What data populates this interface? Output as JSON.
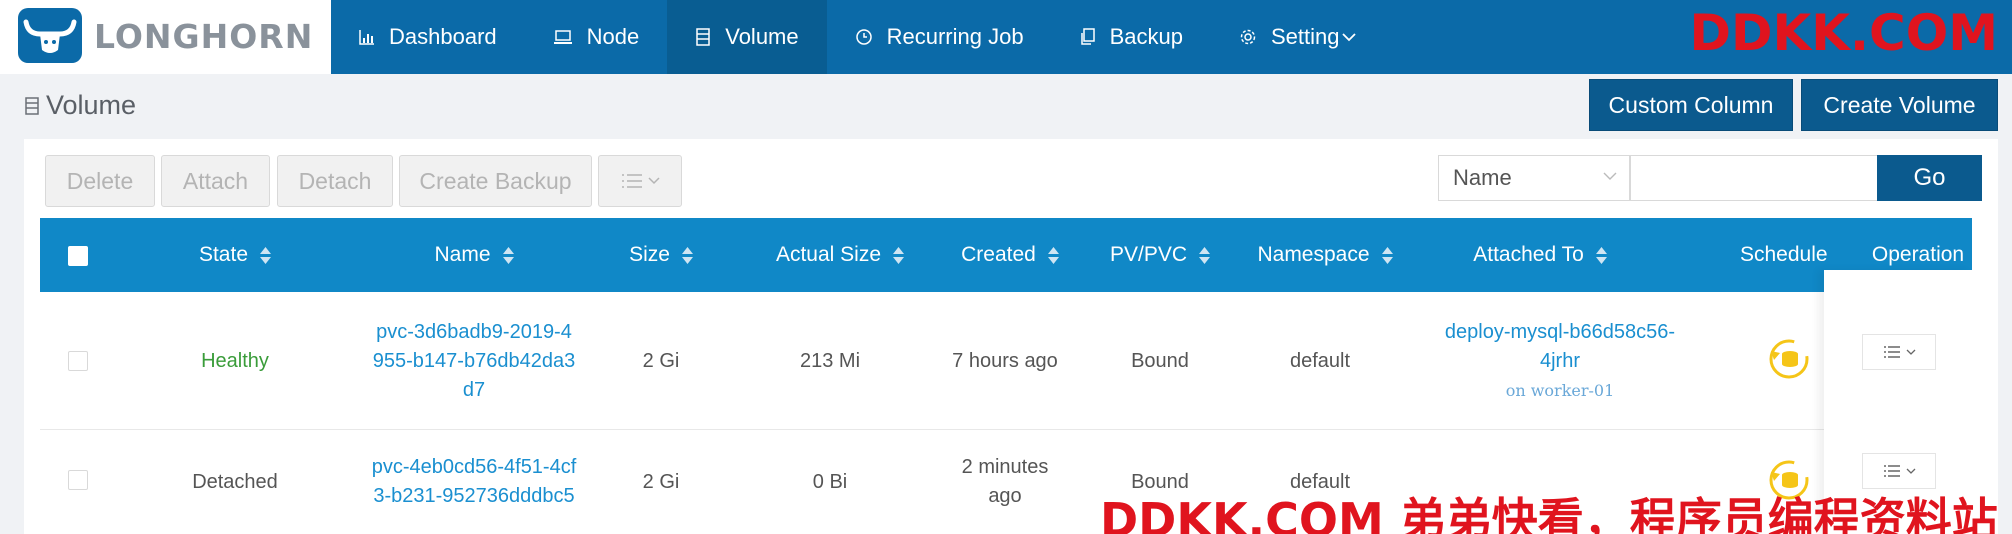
{
  "brand": {
    "name": "LONGHORN",
    "logo_icon": "longhorn-logo-icon"
  },
  "nav": {
    "items": [
      {
        "label": "Dashboard",
        "icon": "bar-chart-icon",
        "active": false
      },
      {
        "label": "Node",
        "icon": "laptop-icon",
        "active": false
      },
      {
        "label": "Volume",
        "icon": "database-icon",
        "active": true
      },
      {
        "label": "Recurring Job",
        "icon": "clock-icon",
        "active": false
      },
      {
        "label": "Backup",
        "icon": "copy-icon",
        "active": false
      },
      {
        "label": "Setting",
        "icon": "gear-icon",
        "active": false
      }
    ]
  },
  "watermark": {
    "top": "DDKK.COM",
    "bottom": "DDKK.COM 弟弟快看，程序员编程资料站"
  },
  "page": {
    "title": "Volume",
    "custom_column_label": "Custom Column",
    "create_volume_label": "Create Volume"
  },
  "toolbar": {
    "delete_label": "Delete",
    "attach_label": "Attach",
    "detach_label": "Detach",
    "create_backup_label": "Create Backup"
  },
  "search": {
    "field_selected": "Name",
    "value": "",
    "go_label": "Go"
  },
  "table": {
    "headers": {
      "state": "State",
      "name": "Name",
      "size": "Size",
      "actual_size": "Actual Size",
      "created": "Created",
      "pv_pvc": "PV/PVC",
      "namespace": "Namespace",
      "attached_to": "Attached To",
      "schedule": "Schedule",
      "operation": "Operation"
    },
    "rows": [
      {
        "state": "Healthy",
        "name_line1": "pvc-3d6badb9-2019-4",
        "name_line2": "955-b147-b76db42da3",
        "name_line3": "d7",
        "size": "2 Gi",
        "actual_size": "213 Mi",
        "created": "7 hours ago",
        "pv_pvc": "Bound",
        "namespace": "default",
        "attached_line1": "deploy-mysql-b66d58c56-",
        "attached_line2": "4jrhr",
        "attached_node": "on worker-01"
      },
      {
        "state": "Detached",
        "name_line1": "pvc-4eb0cd56-4f51-4cf",
        "name_line2": "3-b231-952736dddbc5",
        "size": "2 Gi",
        "actual_size": "0 Bi",
        "created_line1": "2 minutes",
        "created_line2": "ago",
        "pv_pvc": "Bound",
        "namespace": "default"
      }
    ]
  },
  "colors": {
    "nav_bg": "#0b6aa8",
    "nav_active": "#095d92",
    "header_bg": "#1088c7",
    "primary_btn": "#0b5a8e",
    "link": "#1a8fd0",
    "healthy": "#3a9c3a",
    "schedule_icon": "#f5c518",
    "watermark": "#e0141e"
  }
}
